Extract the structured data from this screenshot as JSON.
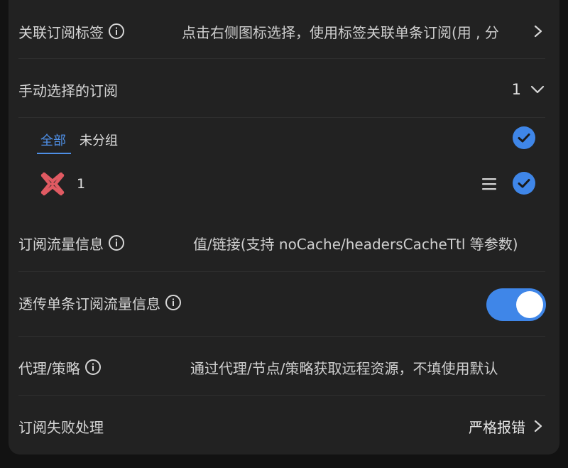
{
  "rows": {
    "tags": {
      "label": "关联订阅标签",
      "value": "点击右侧图标选择，使用标签关联单条订阅(用 , 分"
    },
    "manual": {
      "label": "手动选择的订阅",
      "count": "1"
    },
    "traffic": {
      "label": "订阅流量信息",
      "value": "值/链接(支持 noCache/headersCacheTtl 等参数)"
    },
    "passthrough": {
      "label": "透传单条订阅流量信息",
      "enabled": true
    },
    "proxy": {
      "label": "代理/策略",
      "value": "通过代理/节点/策略获取远程资源，不填使用默认"
    },
    "failure": {
      "label": "订阅失败处理",
      "value": "严格报错"
    }
  },
  "tabs": [
    {
      "label": "全部",
      "active": true
    },
    {
      "label": "未分组",
      "active": false
    }
  ],
  "subscriptions": [
    {
      "name": "1",
      "checked": true
    }
  ],
  "colors": {
    "accent": "#3f86e8",
    "logo": "#e05a62"
  }
}
